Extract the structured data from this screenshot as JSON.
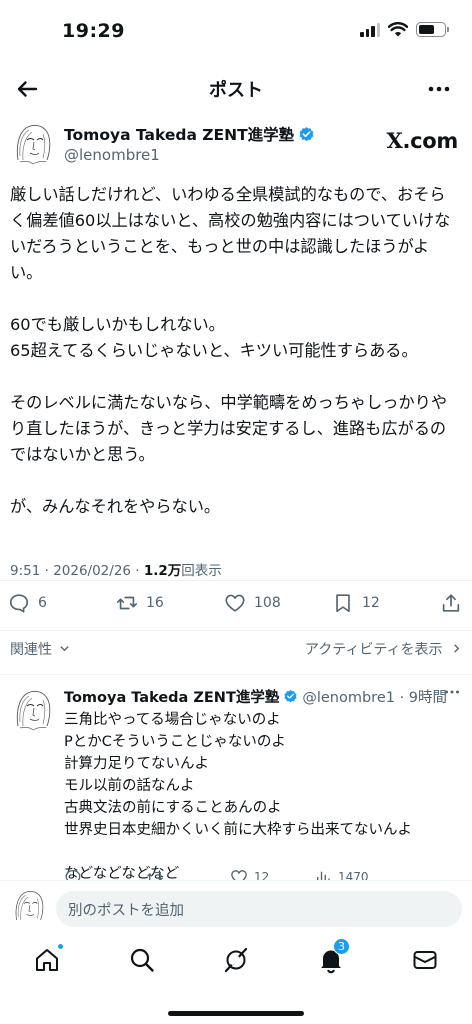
{
  "status_bar": {
    "time": "19:29",
    "battery_level": 0.62,
    "signal_bars": 3
  },
  "nav": {
    "title": "ポスト"
  },
  "post": {
    "author_name": "Tomoya Takeda ZENT進学塾",
    "handle": "@lenombre1",
    "brand": "X.com",
    "paragraphs": [
      "厳しい話しだけれど、いわゆる全県模試的なもので、おそら\nく偏差値60以上はないと、高校の勉強内容にはついていけな\nいだろうということを、もっと世の中は認識したほうがよ\nい。",
      "60でも厳しいかもしれない。\n65超えてるくらいじゃないと、キツい可能性すらある。",
      "そのレベルに満たないなら、中学範疇をめっちゃしっかりや\nり直したほうが、きっと学力は安定するし、進路も広がるの\nではないかと思う。",
      "が、みんなそれをやらない。"
    ],
    "time_date": "9:51 · 2026/02/26 · ",
    "views": "1.2万",
    "views_suffix": "回表示",
    "actions": {
      "replies": "6",
      "reposts": "16",
      "likes": "108",
      "bookmarks": "12"
    }
  },
  "sort": {
    "left_label": "関連性",
    "right_label": "アクティビティを表示"
  },
  "reply": {
    "author_name": "Tomoya Takeda ZENT進学塾",
    "handle_time": "@lenombre1 · 9時間",
    "text": "三角比やってる場合じゃないのよ\nPとかCそういうことじゃないのよ\n計算力足りてないんよ\nモル以前の話なんよ\n古典文法の前にすることあんのよ\n世界史日本史細かくいく前に大枠すら出来てないんよ\n\nなどなどなどなど",
    "partial_counts": {
      "likes": "12",
      "views": "1470"
    }
  },
  "compose": {
    "placeholder": "別のポストを追加"
  },
  "tabbar": {
    "notifications_badge": "3"
  },
  "colors": {
    "accent": "#1d9bf0",
    "verified": "#1d9bf0",
    "secondary_text": "#536471"
  }
}
